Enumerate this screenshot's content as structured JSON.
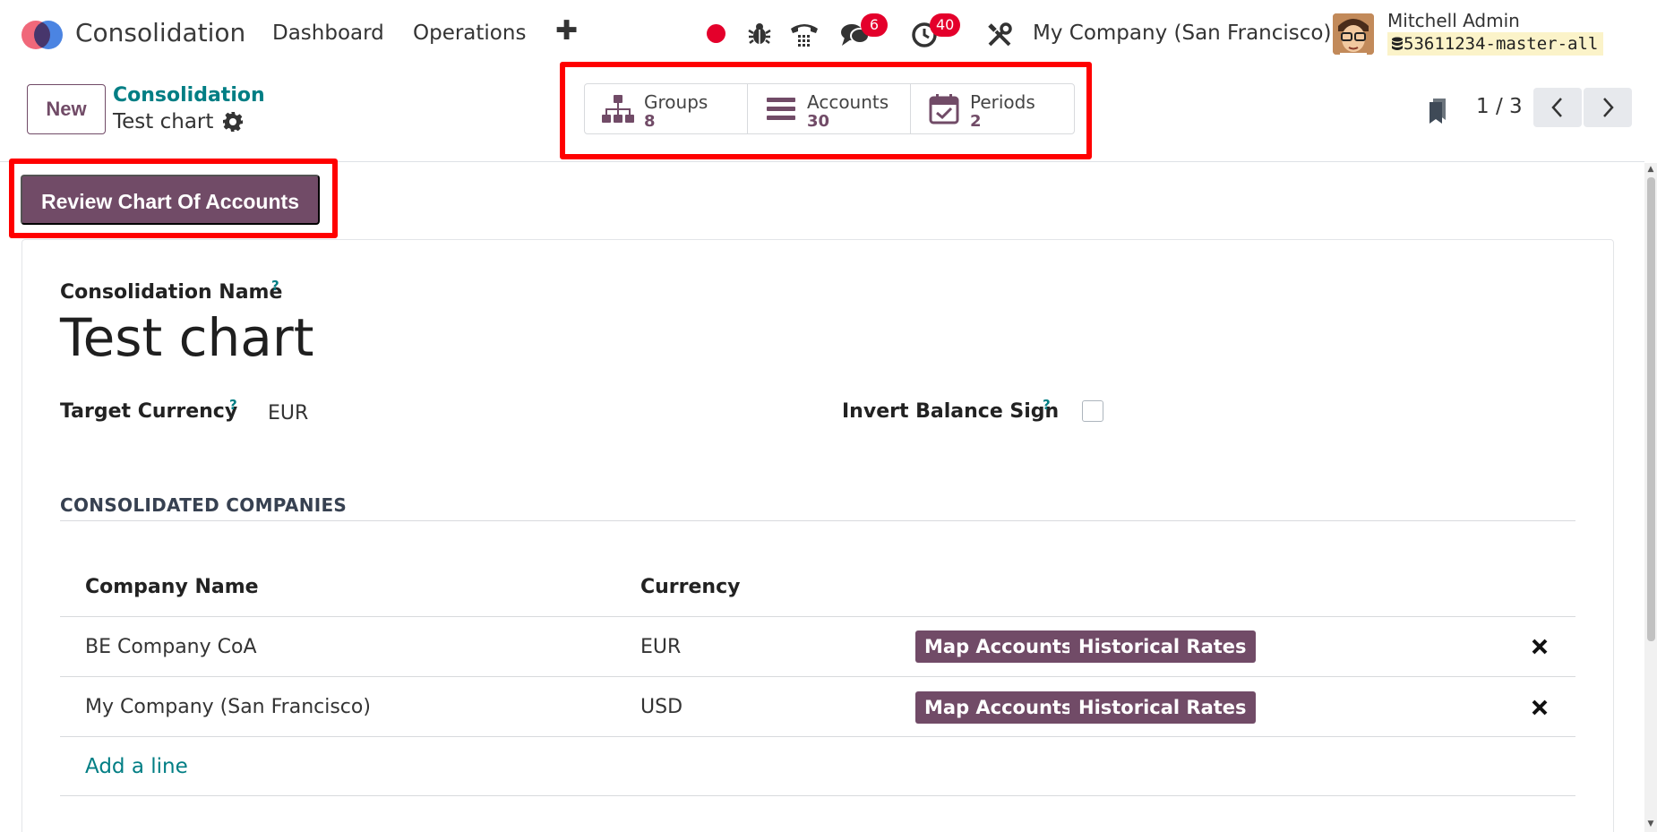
{
  "navbar": {
    "app_title": "Consolidation",
    "menu": [
      "Dashboard",
      "Operations"
    ],
    "badges": {
      "messages": "6",
      "activities": "40"
    },
    "company": "My Company (San Francisco)",
    "user_name": "Mitchell Admin",
    "database": "53611234-master-all"
  },
  "control": {
    "new_label": "New",
    "breadcrumb": "Consolidation",
    "record_name": "Test chart",
    "pager": "1 / 3"
  },
  "smart_buttons": [
    {
      "label": "Groups",
      "value": "8",
      "icon": "hierarchy-icon"
    },
    {
      "label": "Accounts",
      "value": "30",
      "icon": "list-icon"
    },
    {
      "label": "Periods",
      "value": "2",
      "icon": "calendar-check-icon"
    }
  ],
  "actions": {
    "review_label": "Review Chart Of Accounts"
  },
  "form": {
    "name_label": "Consolidation Name",
    "help": "?",
    "name_value": "Test chart",
    "currency_label": "Target Currency",
    "currency_value": "EUR",
    "invert_label": "Invert Balance Sign",
    "invert_checked": false,
    "section_title": "CONSOLIDATED COMPANIES",
    "columns": [
      "Company Name",
      "Currency"
    ],
    "rows": [
      {
        "company": "BE Company CoA",
        "currency": "EUR",
        "map_label": "Map Accounts",
        "rates_label": "Historical Rates"
      },
      {
        "company": "My Company (San Francisco)",
        "currency": "USD",
        "map_label": "Map Accounts",
        "rates_label": "Historical Rates"
      }
    ],
    "add_line": "Add a line"
  },
  "colors": {
    "primary": "#714b67",
    "link": "#017e84",
    "badge": "#e4002b",
    "highlight": "#ff0000"
  }
}
